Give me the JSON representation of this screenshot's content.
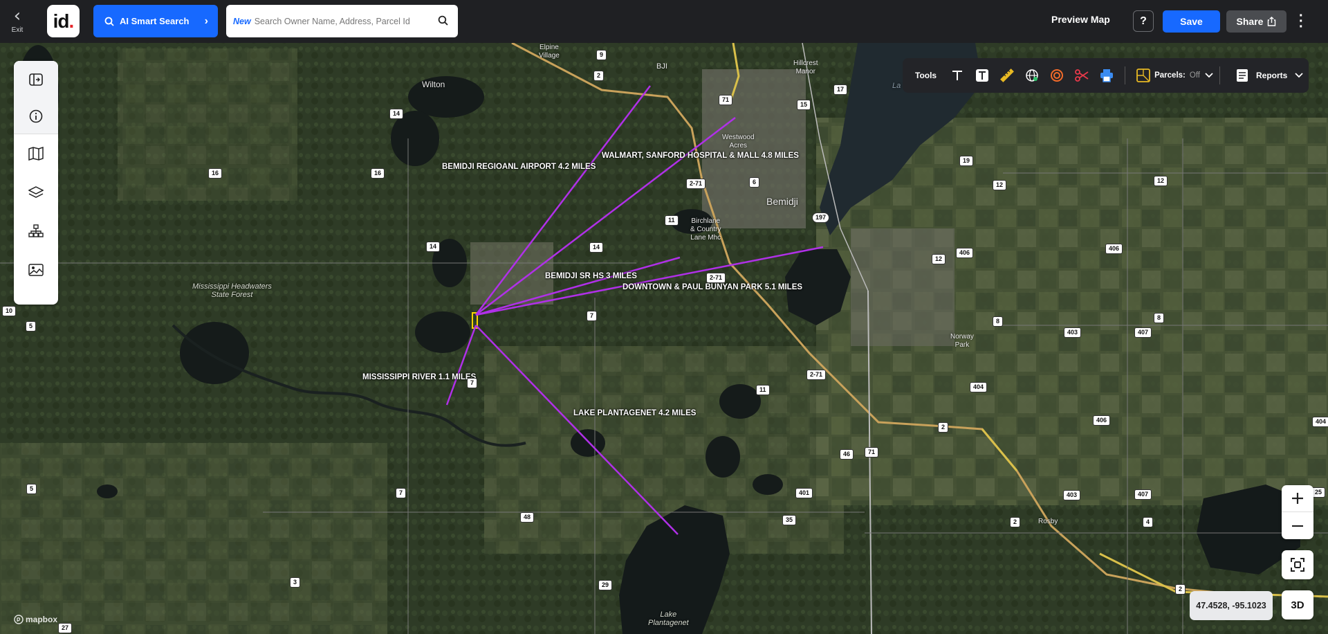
{
  "topbar": {
    "exit_label": "Exit",
    "logo_text": "id",
    "ai_search_label": "AI Smart Search",
    "search_new_tag": "New",
    "search_placeholder": "Search Owner Name, Address, Parcel Id",
    "preview_map_label": "Preview Map",
    "help_label": "?",
    "save_label": "Save",
    "share_label": "Share"
  },
  "sidebar": {
    "items": [
      "collapse-panel-icon",
      "info-icon",
      "map-book-icon",
      "layers-icon",
      "sitemap-icon",
      "image-icon"
    ]
  },
  "tools": {
    "label": "Tools",
    "icons": [
      "text-icon",
      "text-box-icon",
      "ruler-icon",
      "globe-icon",
      "radius-icon",
      "scissors-icon",
      "print-icon"
    ],
    "parcels_label": "Parcels:",
    "parcels_state": "Off",
    "reports_label": "Reports"
  },
  "map": {
    "coords": "47.4528, -95.1023",
    "btn_3d": "3D",
    "attribution": "mapbox",
    "annotations": [
      "BEMIDJI REGIOANL AIRPORT 4.2 MILES",
      "WALMART, SANFORD HOSPITAL & MALL 4.8 MILES",
      "BEMIDJI SR HS 3 MILES",
      "DOWNTOWN & PAUL BUNYAN PARK 5.1 MILES",
      "MISSISSIPPI RIVER 1.1 MILES",
      "LAKE PLANTAGENET 4.2 MILES"
    ],
    "places": {
      "wilton": "Wilton",
      "elpine": "Elpine\nVillage",
      "bji": "BJI",
      "hillcrest": "Hillcrest\nManor",
      "westwood": "Westwood\nAcres",
      "bemidji": "Bemidji",
      "birchlane": "Birchlane\n& Country\nLane Mhc",
      "headwaters": "Mississippi Headwaters\nState Forest",
      "norway": "Norway\nPark",
      "rosby": "Rosby",
      "plantagenet": "Lake\nPlantagenet",
      "la": "La"
    },
    "route_shields": [
      "9",
      "2",
      "71",
      "14",
      "16",
      "16",
      "14",
      "14",
      "11",
      "2-71",
      "6",
      "17",
      "15",
      "197",
      "19",
      "12",
      "12",
      "406",
      "12",
      "406",
      "8",
      "8",
      "403",
      "407",
      "404",
      "406",
      "2",
      "11",
      "2-71",
      "2-71",
      "7",
      "7",
      "46",
      "71",
      "401",
      "35",
      "403",
      "407",
      "4",
      "2",
      "2",
      "48",
      "7",
      "5",
      "5",
      "3",
      "29",
      "27",
      "10",
      "25",
      "404"
    ]
  }
}
